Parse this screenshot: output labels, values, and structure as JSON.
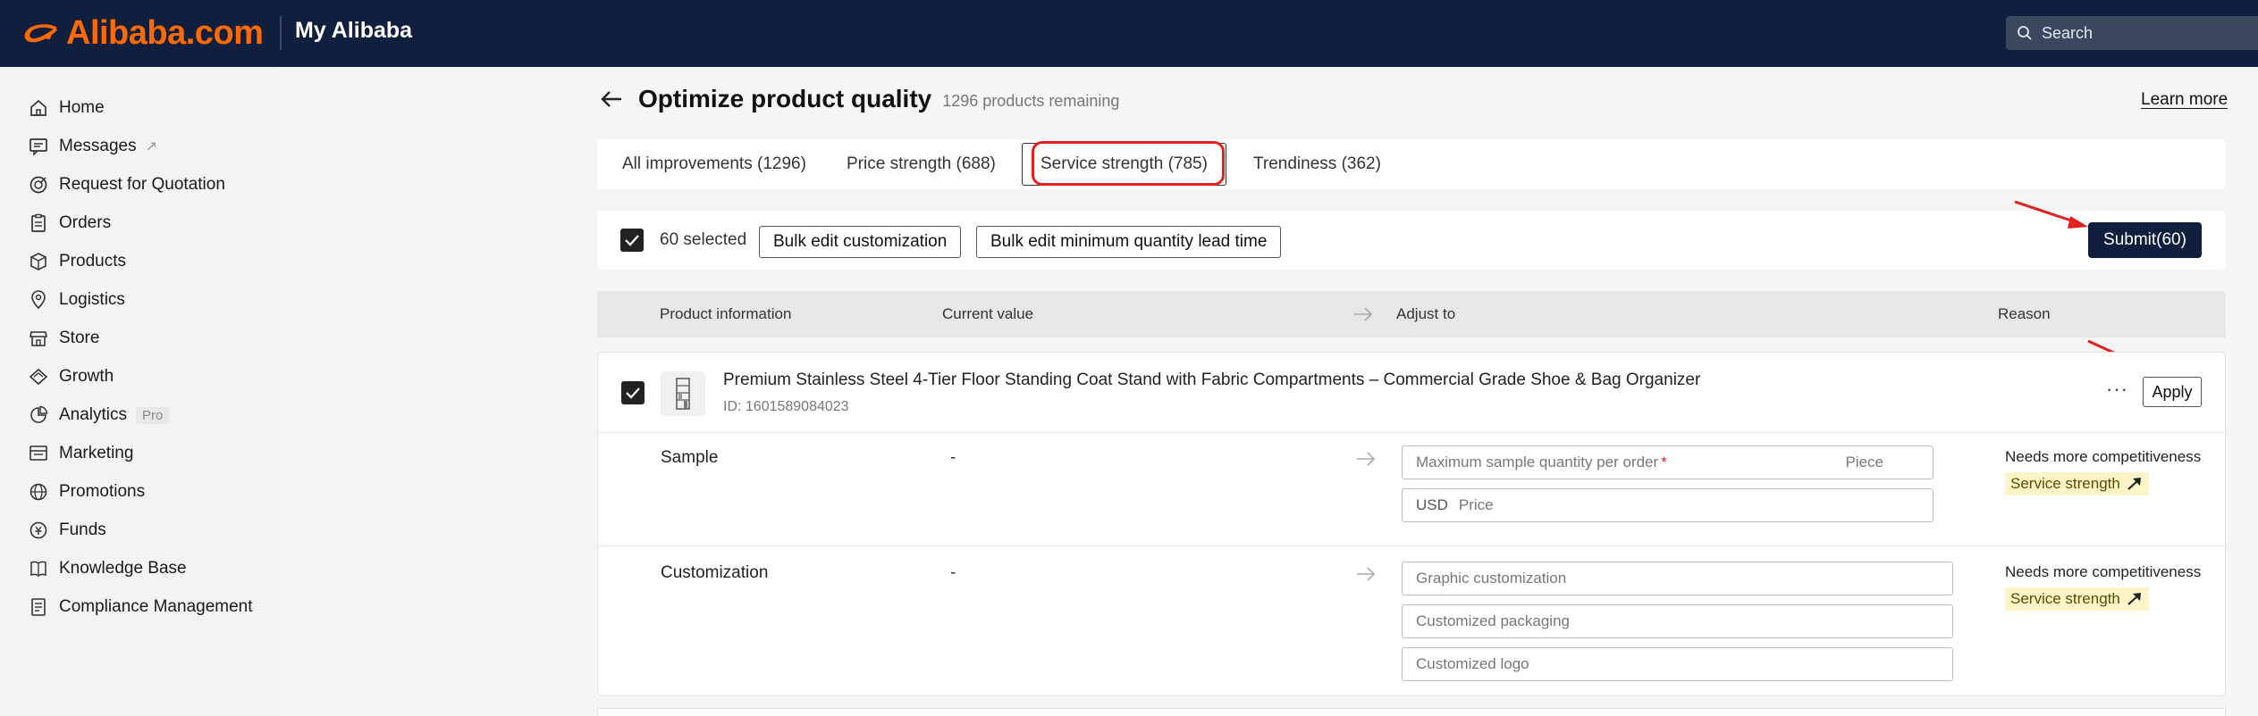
{
  "header": {
    "logo_text": "Alibaba.com",
    "title": "My Alibaba",
    "search_placeholder": "Search"
  },
  "sidebar": {
    "items": [
      {
        "label": "Home",
        "icon": "home-icon"
      },
      {
        "label": "Messages",
        "icon": "message-icon",
        "badge": "↗"
      },
      {
        "label": "Request for Quotation",
        "icon": "rfq-icon"
      },
      {
        "label": "Orders",
        "icon": "orders-icon"
      },
      {
        "label": "Products",
        "icon": "box-icon"
      },
      {
        "label": "Logistics",
        "icon": "logistics-icon"
      },
      {
        "label": "Store",
        "icon": "store-icon"
      },
      {
        "label": "Growth",
        "icon": "growth-icon"
      },
      {
        "label": "Analytics",
        "icon": "analytics-icon",
        "badge": "Pro"
      },
      {
        "label": "Marketing",
        "icon": "marketing-icon"
      },
      {
        "label": "Promotions",
        "icon": "promotions-icon"
      },
      {
        "label": "Funds",
        "icon": "funds-icon"
      },
      {
        "label": "Knowledge Base",
        "icon": "book-icon"
      },
      {
        "label": "Compliance Management",
        "icon": "compliance-icon"
      }
    ]
  },
  "page": {
    "title": "Optimize product quality",
    "remaining": "1296 products remaining",
    "learn_more": "Learn more"
  },
  "tabs": [
    {
      "label": "All improvements (1296)",
      "active": false
    },
    {
      "label": "Price strength (688)",
      "active": false
    },
    {
      "label": "Service strength (785)",
      "active": true
    },
    {
      "label": "Trendiness (362)",
      "active": false
    }
  ],
  "toolbar": {
    "selected": "60 selected",
    "bulk_customization": "Bulk edit customization",
    "bulk_moq": "Bulk edit minimum quantity lead time",
    "submit": "Submit(60)"
  },
  "table": {
    "headers": [
      "Product information",
      "Current value",
      "Adjust to",
      "Reason"
    ]
  },
  "product": {
    "name": "Premium Stainless Steel 4-Tier Floor Standing Coat Stand with Fabric Compartments – Commercial Grade Shoe & Bag Organizer",
    "id": "ID: 1601589084023",
    "more": "···",
    "apply": "Apply",
    "rows": [
      {
        "label": "Sample",
        "current": "-",
        "fields": [
          {
            "placeholder": "Maximum sample quantity per order",
            "required": "*",
            "unit": "Piece"
          },
          {
            "prefix": "USD",
            "placeholder": "Price"
          }
        ],
        "reason": "Needs more competitiveness",
        "badge": "Service strength"
      },
      {
        "label": "Customization",
        "current": "-",
        "fields": [
          {
            "placeholder": "Graphic customization"
          },
          {
            "placeholder": "Customized packaging"
          },
          {
            "placeholder": "Customized logo"
          }
        ],
        "reason": "Needs more competitiveness",
        "badge": "Service strength"
      }
    ]
  },
  "colors": {
    "header_bg": "#0f1f3d",
    "brand": "#ff6a00",
    "highlight_red": "#e32020",
    "badge_bg": "#fdf5c8"
  }
}
